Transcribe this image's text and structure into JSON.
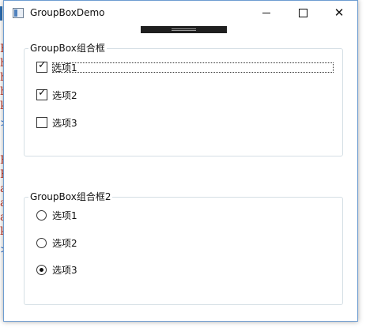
{
  "background": {
    "letters": [
      "F",
      "h",
      "h",
      "h",
      "k",
      ">",
      "H",
      "F",
      "a",
      "a",
      "a",
      "k",
      ">"
    ]
  },
  "window": {
    "title": "GroupBoxDemo",
    "icons": {
      "app": "window-app-icon",
      "minimize": "minimize-icon",
      "maximize": "maximize-icon",
      "close": "close-icon"
    },
    "close_glyph": "✕"
  },
  "groupbox1": {
    "header": "GroupBox组合框",
    "options": [
      {
        "label": "选项1",
        "checked": true,
        "focused": true
      },
      {
        "label": "选项2",
        "checked": true,
        "focused": false
      },
      {
        "label": "选项3",
        "checked": false,
        "focused": false
      }
    ],
    "check_glyph": "✓"
  },
  "groupbox2": {
    "header": "GroupBox组合框2",
    "options": [
      {
        "label": "选项1",
        "selected": false
      },
      {
        "label": "选项2",
        "selected": false
      },
      {
        "label": "选项3",
        "selected": true
      }
    ]
  },
  "colors": {
    "window_border": "#6e9dd1",
    "groupbox_border": "#d5dfe5",
    "background_text": "#c0392b"
  }
}
